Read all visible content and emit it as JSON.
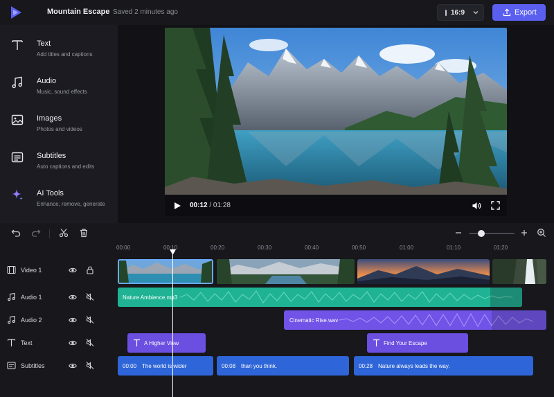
{
  "header": {
    "project_title": "Mountain Escape",
    "saved_status": "Saved 2 minutes ago",
    "aspect_ratio": "16:9",
    "export_label": "Export",
    "accent_color": "#5b5ff0"
  },
  "sidebar": {
    "items": [
      {
        "title": "Text",
        "subtitle": "Add titles and captions",
        "icon": "text-icon"
      },
      {
        "title": "Audio",
        "subtitle": "Music, sound effects",
        "icon": "music-note-icon"
      },
      {
        "title": "Images",
        "subtitle": "Photos and videos",
        "icon": "image-icon"
      },
      {
        "title": "Subtitles",
        "subtitle": "Auto captions and edits",
        "icon": "subtitles-icon"
      },
      {
        "title": "AI Tools",
        "subtitle": "Enhance, remove, generate",
        "icon": "sparkle-icon"
      }
    ]
  },
  "player": {
    "current_time": "00:12",
    "separator": " / ",
    "duration": "01:28"
  },
  "timeline": {
    "ticks": [
      "00:00",
      "00:10",
      "00:20",
      "00:30",
      "00:40",
      "00:50",
      "01:00",
      "01:10",
      "01:20"
    ],
    "tracks": [
      {
        "name": "Video 1",
        "icon": "film-icon",
        "lock": "lock-icon"
      },
      {
        "name": "Audio 1",
        "icon": "music-note-icon",
        "lock": "mute-icon"
      },
      {
        "name": "Audio 2",
        "icon": "music-note-icon",
        "lock": "mute-icon"
      },
      {
        "name": "Text",
        "icon": "text-icon",
        "lock": "mute-icon"
      },
      {
        "name": "Subtitles",
        "icon": "subtitles-icon",
        "lock": "mute-icon"
      }
    ],
    "audio_clips": [
      "Nature Ambience.mp3",
      "Cinematic Rise.wav"
    ],
    "text_clips": [
      "A Higher View",
      "Find Your Escape"
    ],
    "subtitle_clips": [
      {
        "time": "00:00",
        "text": "The world is wider"
      },
      {
        "time": "00:08",
        "text": "than you think."
      },
      {
        "time": "00:28",
        "text": "Nature always leads the way."
      }
    ],
    "colors": {
      "audio1": "#1fb394",
      "audio2": "#7153e8",
      "text": "#6a4fe0",
      "subtitles": "#2e65d8"
    }
  }
}
